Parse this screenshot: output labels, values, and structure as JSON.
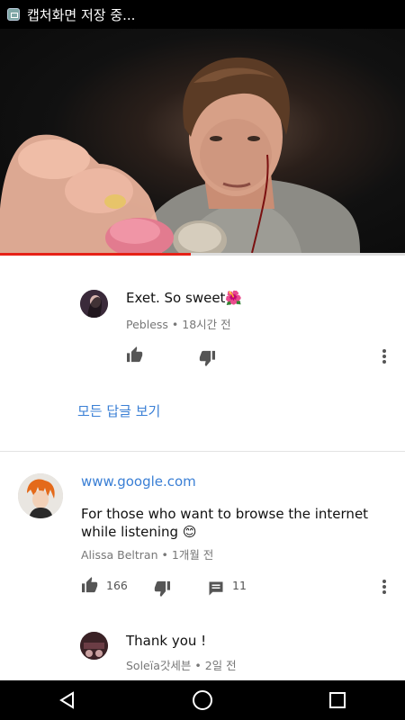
{
  "status_bar": {
    "text": "캡처화면 저장 중..."
  },
  "video": {
    "progress_fraction": 0.47
  },
  "comments": [
    {
      "text": "Exet. So sweet🌺",
      "author": "Pebless",
      "time": "18시간 전",
      "view_replies": "모든 답글 보기"
    },
    {
      "link": "www.google.com",
      "text": "For those who want to browse the internet while listening 😊",
      "author": "Alissa Beltran",
      "time": "1개월 전",
      "like_count": "166",
      "reply_count": "11"
    },
    {
      "text": "Thank you !",
      "author": "Soleïa갓세븐",
      "time": "2일 전"
    }
  ],
  "meta_separator": "•",
  "icons": {
    "like": "thumbs-up-icon",
    "dislike": "thumbs-down-icon",
    "reply": "comment-icon",
    "more": "more-vert-icon",
    "back": "back-triangle-icon",
    "home": "home-circle-icon",
    "recents": "recents-square-icon"
  },
  "colors": {
    "accent_link": "#3a7fd5",
    "progress": "#e62117"
  }
}
